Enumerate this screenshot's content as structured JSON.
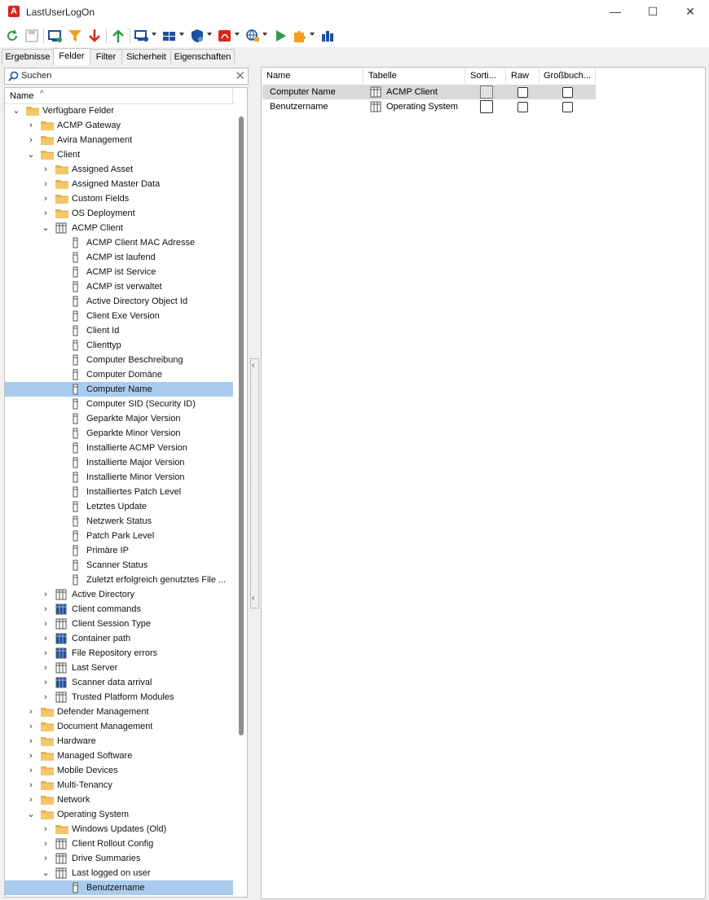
{
  "window": {
    "title": "LastUserLogOn",
    "controls": {
      "minimize": "—",
      "maximize": "☐",
      "close": "✕"
    }
  },
  "toolbar": {
    "icons": [
      "refresh-icon",
      "save-icon",
      "monitor-icon",
      "filter-icon",
      "arrow-down-icon",
      "arrow-up-icon",
      "display-settings-icon",
      "grid-icon",
      "shield-icon",
      "acrobat-icon",
      "globe-icon",
      "play-icon",
      "puzzle-icon",
      "chart-icon"
    ]
  },
  "tabs": [
    "Ergebnisse",
    "Felder",
    "Filter",
    "Sicherheit",
    "Eigenschaften"
  ],
  "active_tab": "Felder",
  "search": {
    "placeholder": "Suchen"
  },
  "tree": {
    "header": "Name",
    "rows": [
      {
        "label": "Verfügbare Felder",
        "level": 0,
        "icon": "folder",
        "expand": "open"
      },
      {
        "label": "ACMP Gateway",
        "level": 1,
        "icon": "folder",
        "expand": "closed"
      },
      {
        "label": "Avira Management",
        "level": 1,
        "icon": "folder",
        "expand": "closed"
      },
      {
        "label": "Client",
        "level": 1,
        "icon": "folder",
        "expand": "open"
      },
      {
        "label": "Assigned Asset",
        "level": 2,
        "icon": "folder",
        "expand": "closed"
      },
      {
        "label": "Assigned Master Data",
        "level": 2,
        "icon": "folder",
        "expand": "closed"
      },
      {
        "label": "Custom Fields",
        "level": 2,
        "icon": "folder",
        "expand": "closed"
      },
      {
        "label": "OS Deployment",
        "level": 2,
        "icon": "folder",
        "expand": "closed"
      },
      {
        "label": "ACMP Client",
        "level": 2,
        "icon": "table",
        "expand": "open"
      },
      {
        "label": "ACMP Client MAC Adresse",
        "level": 3,
        "icon": "field",
        "expand": "none"
      },
      {
        "label": "ACMP ist laufend",
        "level": 3,
        "icon": "field",
        "expand": "none"
      },
      {
        "label": "ACMP ist Service",
        "level": 3,
        "icon": "field",
        "expand": "none"
      },
      {
        "label": "ACMP ist verwaltet",
        "level": 3,
        "icon": "field",
        "expand": "none"
      },
      {
        "label": "Active Directory Object Id",
        "level": 3,
        "icon": "field",
        "expand": "none"
      },
      {
        "label": "Client Exe Version",
        "level": 3,
        "icon": "field",
        "expand": "none"
      },
      {
        "label": "Client Id",
        "level": 3,
        "icon": "field",
        "expand": "none"
      },
      {
        "label": "Clienttyp",
        "level": 3,
        "icon": "field",
        "expand": "none"
      },
      {
        "label": "Computer Beschreibung",
        "level": 3,
        "icon": "field",
        "expand": "none"
      },
      {
        "label": "Computer Domäne",
        "level": 3,
        "icon": "field",
        "expand": "none"
      },
      {
        "label": "Computer Name",
        "level": 3,
        "icon": "field",
        "expand": "none",
        "selected": true
      },
      {
        "label": "Computer SID (Security ID)",
        "level": 3,
        "icon": "field",
        "expand": "none"
      },
      {
        "label": "Geparkte Major Version",
        "level": 3,
        "icon": "field",
        "expand": "none"
      },
      {
        "label": "Geparkte Minor Version",
        "level": 3,
        "icon": "field",
        "expand": "none"
      },
      {
        "label": "Installierte ACMP Version",
        "level": 3,
        "icon": "field",
        "expand": "none"
      },
      {
        "label": "Installierte Major Version",
        "level": 3,
        "icon": "field",
        "expand": "none"
      },
      {
        "label": "Installierte Minor Version",
        "level": 3,
        "icon": "field",
        "expand": "none"
      },
      {
        "label": "Installiertes Patch Level",
        "level": 3,
        "icon": "field",
        "expand": "none"
      },
      {
        "label": "Letztes Update",
        "level": 3,
        "icon": "field",
        "expand": "none"
      },
      {
        "label": "Netzwerk Status",
        "level": 3,
        "icon": "field",
        "expand": "none"
      },
      {
        "label": "Patch Park Level",
        "level": 3,
        "icon": "field",
        "expand": "none"
      },
      {
        "label": "Primäre IP",
        "level": 3,
        "icon": "field",
        "expand": "none"
      },
      {
        "label": "Scanner Status",
        "level": 3,
        "icon": "field",
        "expand": "none"
      },
      {
        "label": "Zuletzt erfolgreich genutztes File ...",
        "level": 3,
        "icon": "field",
        "expand": "none"
      },
      {
        "label": "Active Directory",
        "level": 2,
        "icon": "table",
        "expand": "closed"
      },
      {
        "label": "Client commands",
        "level": 2,
        "icon": "table-blue",
        "expand": "closed"
      },
      {
        "label": "Client Session Type",
        "level": 2,
        "icon": "table",
        "expand": "closed"
      },
      {
        "label": "Container path",
        "level": 2,
        "icon": "table-blue",
        "expand": "closed"
      },
      {
        "label": "File Repository errors",
        "level": 2,
        "icon": "table-blue",
        "expand": "closed"
      },
      {
        "label": "Last Server",
        "level": 2,
        "icon": "table",
        "expand": "closed"
      },
      {
        "label": "Scanner data arrival",
        "level": 2,
        "icon": "table-blue",
        "expand": "closed"
      },
      {
        "label": "Trusted Platform Modules",
        "level": 2,
        "icon": "table",
        "expand": "closed"
      },
      {
        "label": "Defender Management",
        "level": 1,
        "icon": "folder",
        "expand": "closed"
      },
      {
        "label": "Document Management",
        "level": 1,
        "icon": "folder",
        "expand": "closed"
      },
      {
        "label": "Hardware",
        "level": 1,
        "icon": "folder",
        "expand": "closed"
      },
      {
        "label": "Managed Software",
        "level": 1,
        "icon": "folder",
        "expand": "closed"
      },
      {
        "label": "Mobile Devices",
        "level": 1,
        "icon": "folder",
        "expand": "closed"
      },
      {
        "label": "Multi-Tenancy",
        "level": 1,
        "icon": "folder",
        "expand": "closed"
      },
      {
        "label": "Network",
        "level": 1,
        "icon": "folder",
        "expand": "closed"
      },
      {
        "label": "Operating System",
        "level": 1,
        "icon": "folder",
        "expand": "open"
      },
      {
        "label": "Windows Updates (Old)",
        "level": 2,
        "icon": "folder",
        "expand": "closed"
      },
      {
        "label": "Client Rollout Config",
        "level": 2,
        "icon": "table",
        "expand": "closed"
      },
      {
        "label": "Drive Summaries",
        "level": 2,
        "icon": "table",
        "expand": "closed"
      },
      {
        "label": "Last logged on user",
        "level": 2,
        "icon": "table",
        "expand": "open"
      },
      {
        "label": "Benutzername",
        "level": 3,
        "icon": "field",
        "expand": "none",
        "selected": true
      }
    ]
  },
  "grid": {
    "columns": [
      "Name",
      "Tabelle",
      "Sorti...",
      "Raw",
      "Großbuch..."
    ],
    "rows": [
      {
        "name": "Computer Name",
        "table": "ACMP Client",
        "sort": false,
        "raw": false,
        "upper": false,
        "selected": true
      },
      {
        "name": "Benutzername",
        "table": "Operating System",
        "sort": false,
        "raw": false,
        "upper": false,
        "selected": false
      }
    ]
  },
  "colors": {
    "selection": "#a9cbed",
    "folder": "#e8b04c",
    "accent_red": "#d9261c",
    "table_blue": "#1e4f9c"
  }
}
